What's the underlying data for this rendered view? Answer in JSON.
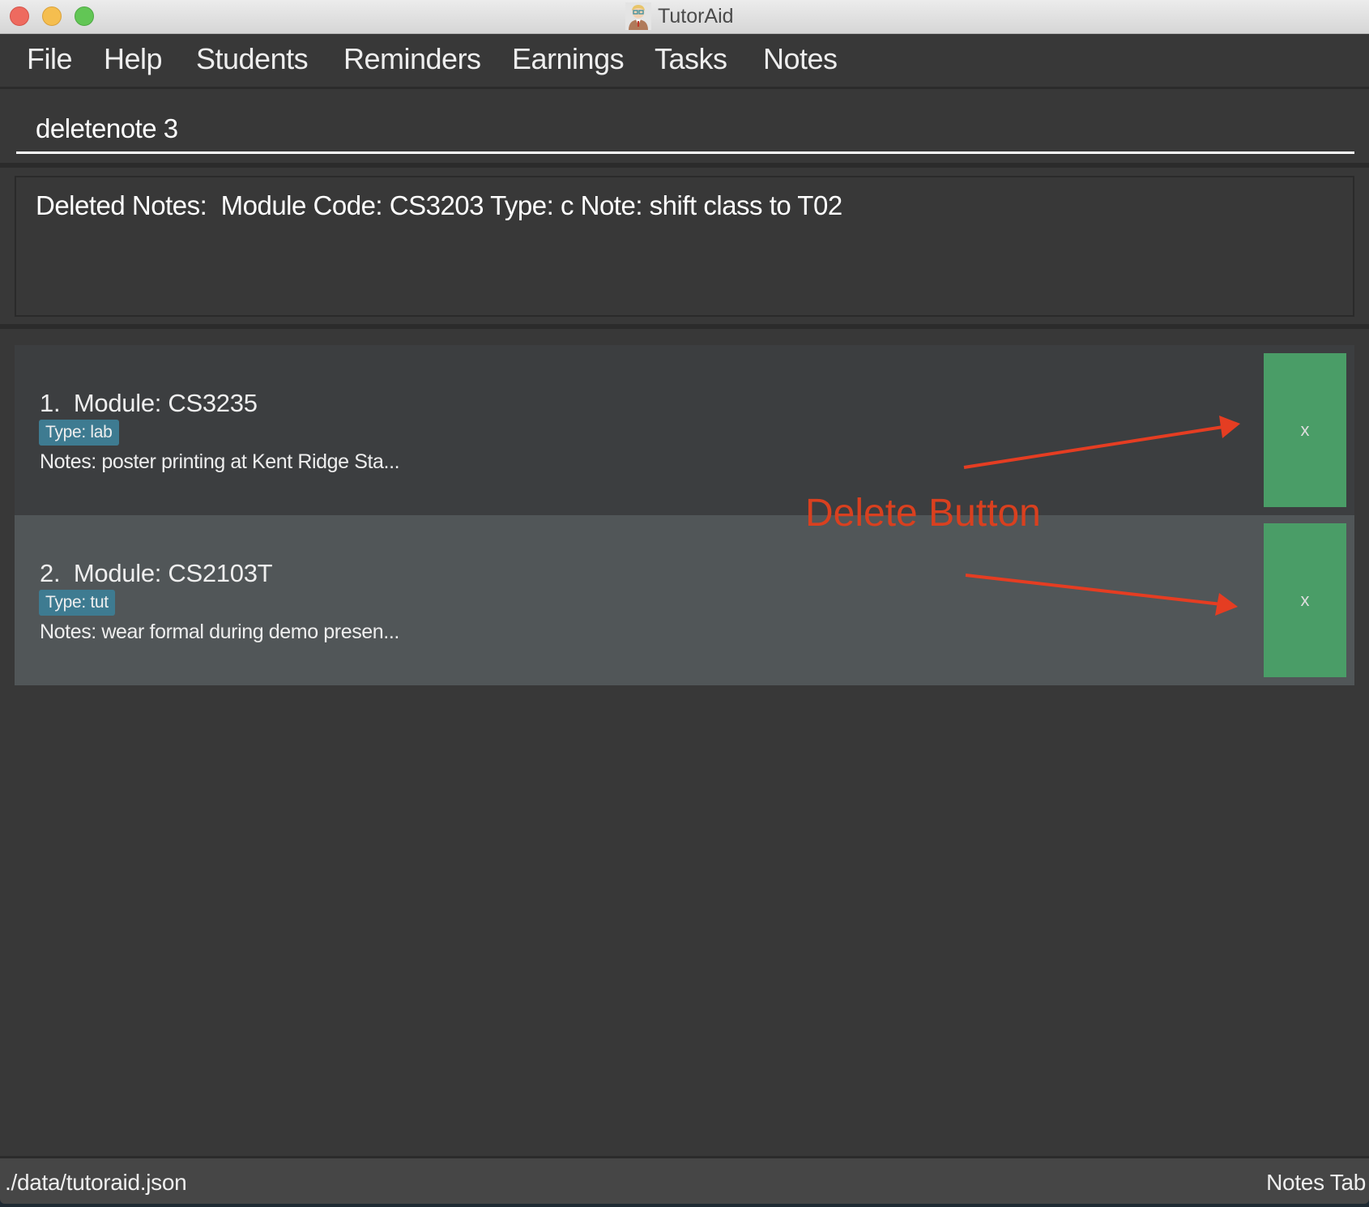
{
  "window": {
    "title": "TutorAid",
    "icon": "tutor-avatar-icon"
  },
  "menu": {
    "items": [
      {
        "label": "File"
      },
      {
        "label": "Help"
      },
      {
        "label": "Students"
      },
      {
        "label": "Reminders"
      },
      {
        "label": "Earnings"
      },
      {
        "label": "Tasks"
      },
      {
        "label": "Notes"
      }
    ]
  },
  "command": {
    "value": "deletenote 3"
  },
  "result": {
    "text": "Deleted Notes:  Module Code: CS3203 Type: c Note: shift class to T02"
  },
  "notes": [
    {
      "index": "1.",
      "title": "Module: CS3235",
      "tag": "Type: lab",
      "notes": "Notes: poster printing at Kent Ridge Sta...",
      "delete_label": "x"
    },
    {
      "index": "2.",
      "title": "Module: CS2103T",
      "tag": "Type: tut",
      "notes": "Notes: wear formal during demo presen...",
      "delete_label": "x"
    }
  ],
  "annotation": {
    "label": "Delete Button",
    "color": "#d9401f"
  },
  "status": {
    "path": "./data/tutoraid.json",
    "tab": "Notes Tab"
  },
  "colors": {
    "background": "#383838",
    "tag": "#3e7b91",
    "delete_button": "#4a9d67",
    "card_odd": "#3c3e40",
    "card_even": "#515658"
  }
}
